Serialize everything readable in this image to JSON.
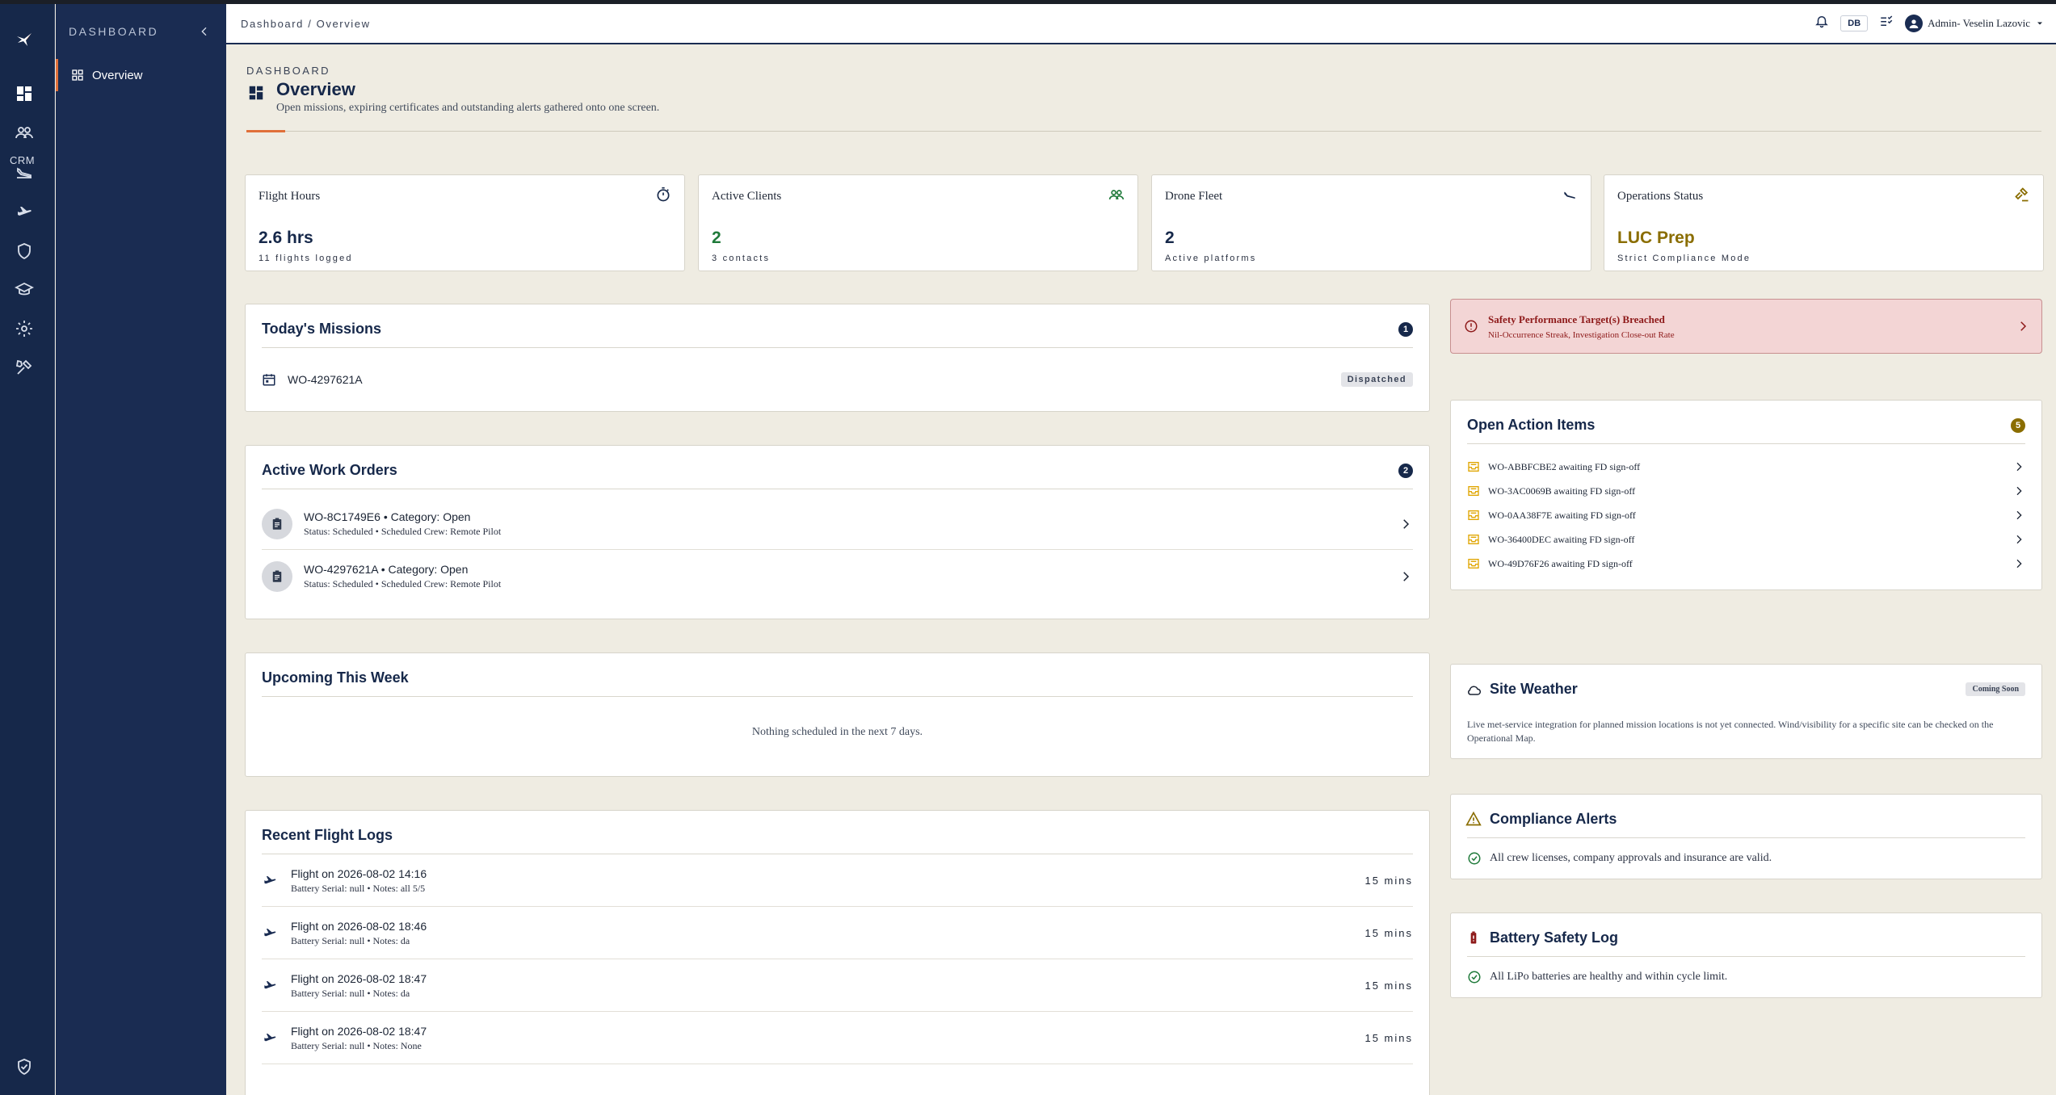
{
  "nav": {
    "title": "DASHBOARD",
    "crm_label": "CRM",
    "items": [
      {
        "label": "Overview"
      }
    ]
  },
  "header": {
    "breadcrumb": "Dashboard / Overview",
    "db_badge": "DB",
    "user": "Admin- Veselin Lazovic"
  },
  "page": {
    "kicker": "DASHBOARD",
    "title": "Overview",
    "subtitle": "Open missions, expiring certificates and outstanding alerts gathered onto one screen."
  },
  "stats": [
    {
      "label": "Flight Hours",
      "value": "2.6 hrs",
      "sub": "11 flights logged",
      "icon": "stopwatch-icon",
      "color": "#16284a"
    },
    {
      "label": "Active Clients",
      "value": "2",
      "sub": "3 contacts",
      "icon": "people-icon",
      "color": "#1f7a3a"
    },
    {
      "label": "Drone Fleet",
      "value": "2",
      "sub": "Active platforms",
      "icon": "flight-land-icon",
      "color": "#16284a"
    },
    {
      "label": "Operations Status",
      "value": "LUC Prep",
      "sub": "Strict Compliance Mode",
      "icon": "gavel-icon",
      "color": "#8a6d00"
    }
  ],
  "todays_missions": {
    "title": "Today's Missions",
    "count": "1",
    "items": [
      {
        "id": "WO-4297621A",
        "status": "Dispatched"
      }
    ]
  },
  "work_orders": {
    "title": "Active Work Orders",
    "count": "2",
    "items": [
      {
        "title": "WO-8C1749E6 • Category: Open",
        "sub": "Status: Scheduled • Scheduled Crew: Remote Pilot"
      },
      {
        "title": "WO-4297621A • Category: Open",
        "sub": "Status: Scheduled • Scheduled Crew: Remote Pilot"
      }
    ]
  },
  "upcoming": {
    "title": "Upcoming This Week",
    "empty": "Nothing scheduled in the next 7 days."
  },
  "flight_logs": {
    "title": "Recent Flight Logs",
    "items": [
      {
        "title": "Flight on 2026-08-02 14:16",
        "sub": "Battery Serial: null • Notes: all 5/5",
        "duration": "15 mins"
      },
      {
        "title": "Flight on 2026-08-02 18:46",
        "sub": "Battery Serial: null • Notes: da",
        "duration": "15 mins"
      },
      {
        "title": "Flight on 2026-08-02 18:47",
        "sub": "Battery Serial: null • Notes: da",
        "duration": "15 mins"
      },
      {
        "title": "Flight on 2026-08-02 18:47",
        "sub": "Battery Serial: null • Notes: None",
        "duration": "15 mins"
      }
    ]
  },
  "safety_alert": {
    "title": "Safety Performance Target(s) Breached",
    "sub": "Nil-Occurrence Streak, Investigation Close-out Rate"
  },
  "action_items": {
    "title": "Open Action Items",
    "count": "5",
    "items": [
      {
        "text": "WO-ABBFCBE2 awaiting FD sign-off"
      },
      {
        "text": "WO-3AC0069B awaiting FD sign-off"
      },
      {
        "text": "WO-0AA38F7E awaiting FD sign-off"
      },
      {
        "text": "WO-36400DEC awaiting FD sign-off"
      },
      {
        "text": "WO-49D76F26 awaiting FD sign-off"
      }
    ]
  },
  "weather": {
    "title": "Site Weather",
    "badge": "Coming Soon",
    "body": "Live met-service integration for planned mission locations is not yet connected. Wind/visibility for a specific site can be checked on the Operational Map."
  },
  "compliance": {
    "title": "Compliance Alerts",
    "message": "All crew licenses, company approvals and insurance are valid."
  },
  "battery": {
    "title": "Battery Safety Log",
    "message": "All LiPo batteries are healthy and within cycle limit."
  },
  "colors": {
    "navy": "#16284a",
    "accent": "#e0703a",
    "alert_bg": "#f3d5d5",
    "alert_text": "#8e1a1a",
    "ok_green": "#1f7a3a",
    "gold": "#8a6d00"
  }
}
